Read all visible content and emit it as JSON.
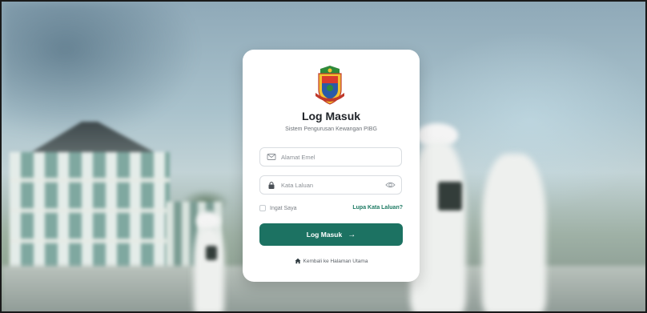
{
  "login": {
    "title": "Log Masuk",
    "subtitle": "Sistem Pengurusan Kewangan PIBG",
    "email": {
      "placeholder": "Alamat Emel",
      "value": "",
      "icon": "envelope-icon"
    },
    "password": {
      "placeholder": "Kata Laluan",
      "value": "",
      "icon": "lock-icon",
      "toggle_icon": "eye-icon"
    },
    "remember_label": "Ingat Saya",
    "remember_checked": false,
    "forgot_label": "Lupa Kata Laluan?",
    "submit_label": "Log Masuk",
    "submit_icon": "arrow-right-icon",
    "back_label": "Kembali ke Halaman Utama",
    "back_icon": "home-icon"
  },
  "colors": {
    "primary": "#1c7262",
    "link": "#1d7a63",
    "card": "#ffffff"
  }
}
